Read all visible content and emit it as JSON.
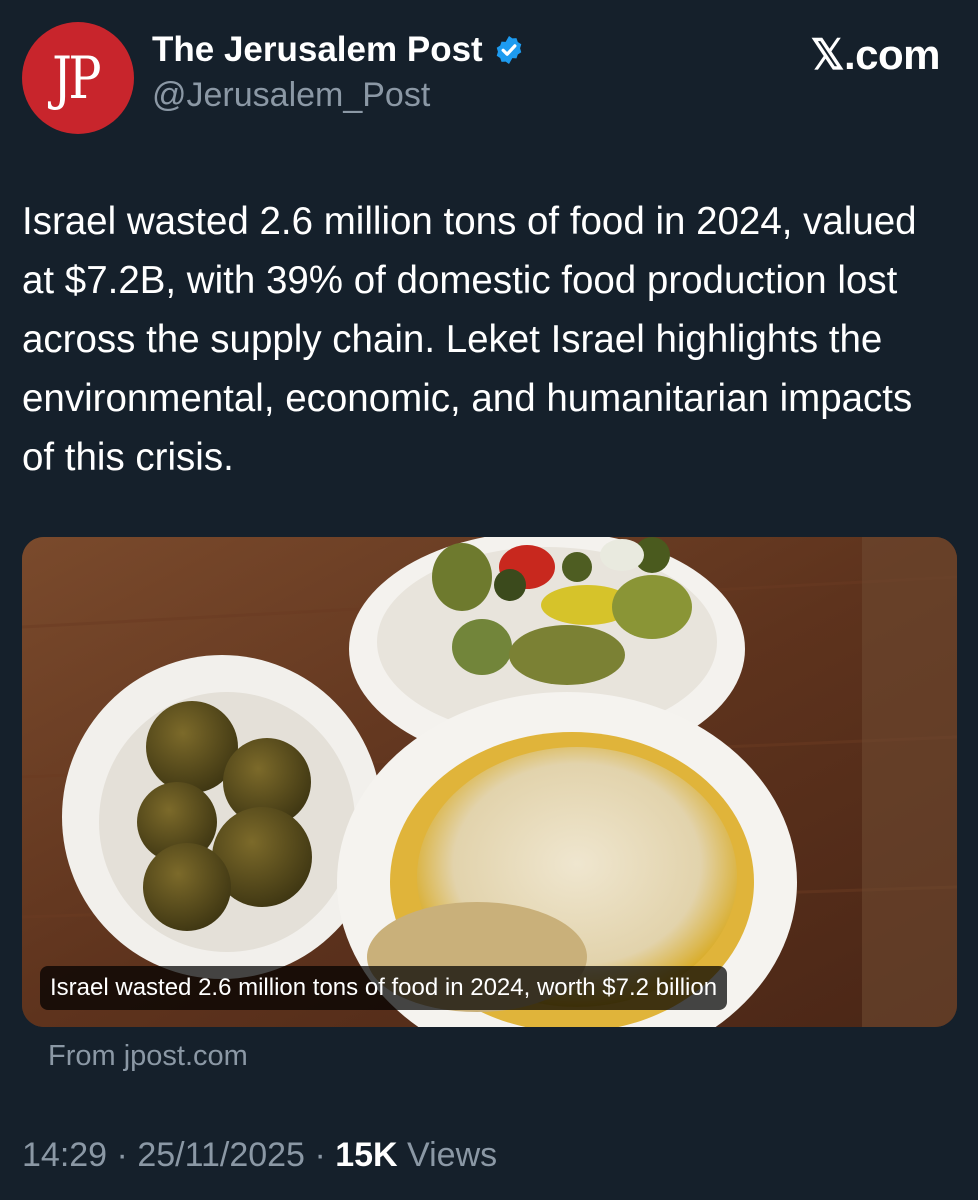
{
  "author": {
    "avatar_text": "JP",
    "name": "The Jerusalem Post",
    "handle": "@Jerusalem_Post",
    "verified_icon": "verified-badge-icon"
  },
  "brand": "𝕏.com",
  "tweet": {
    "text": "Israel wasted 2.6 million tons of food in 2024, valued at $7.2B, with 39% of domestic food production lost across the supply chain. Leket Israel highlights the environmental, economic, and humanitarian impacts of this crisis."
  },
  "link_card": {
    "caption": "Israel wasted 2.6 million tons of food in 2024, worth $7.2 billion",
    "source": "From jpost.com"
  },
  "meta": {
    "time": "14:29",
    "separator": "·",
    "date": "25/11/2025",
    "views_count": "15K",
    "views_label": "Views"
  },
  "colors": {
    "background": "#15202b",
    "secondary_text": "#8b98a5",
    "verified": "#1d9bf0",
    "avatar_bg": "#c8252c"
  }
}
